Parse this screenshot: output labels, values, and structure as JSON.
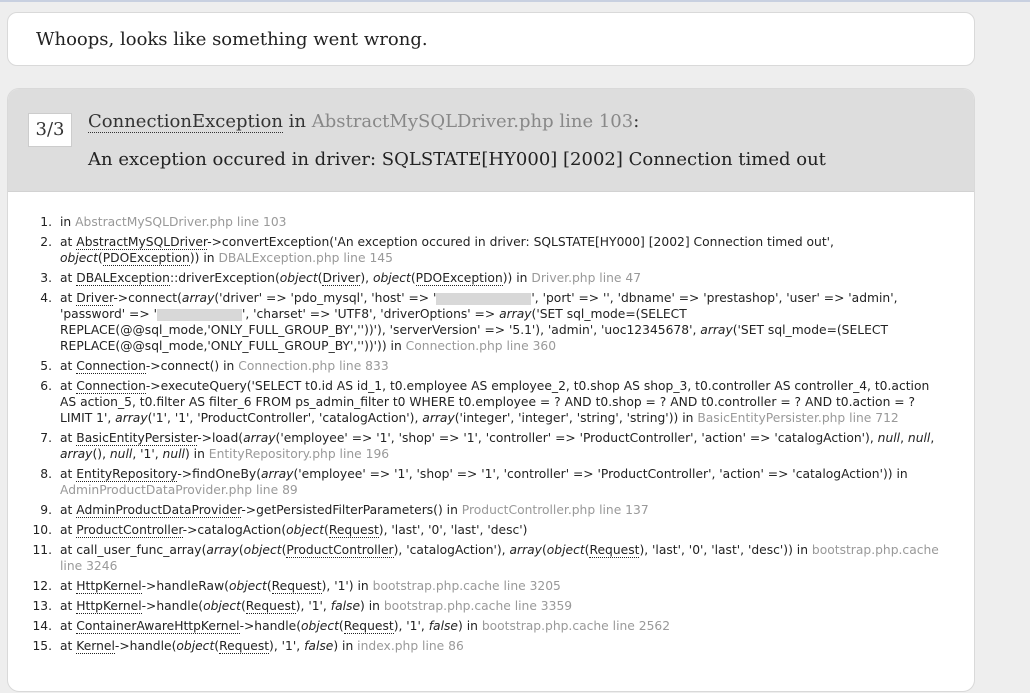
{
  "page": {
    "headline": "Whoops, looks like something went wrong."
  },
  "exception": {
    "counter": "3/3",
    "class_name": "ConnectionException",
    "in_text": "in",
    "location": "AbstractMySQLDriver.php line 103",
    "colon": ":",
    "message": "An exception occured in driver: SQLSTATE[HY000] [2002] Connection timed out"
  },
  "traces": [
    {
      "n": "1.",
      "parts": [
        [
          "t",
          "in "
        ],
        [
          "f",
          "AbstractMySQLDriver.php line 103"
        ]
      ]
    },
    {
      "n": "2.",
      "parts": [
        [
          "t",
          "at "
        ],
        [
          "c",
          "AbstractMySQLDriver"
        ],
        [
          "t",
          "->convertException('An exception occured in driver: SQLSTATE[HY000] [2002] Connection timed out', "
        ],
        [
          "i",
          "object"
        ],
        [
          "t",
          "("
        ],
        [
          "c",
          "PDOException"
        ],
        [
          "t",
          ")) in "
        ],
        [
          "f",
          "DBALException.php line 145"
        ]
      ]
    },
    {
      "n": "3.",
      "parts": [
        [
          "t",
          "at "
        ],
        [
          "c",
          "DBALException"
        ],
        [
          "t",
          "::driverException("
        ],
        [
          "i",
          "object"
        ],
        [
          "t",
          "("
        ],
        [
          "c",
          "Driver"
        ],
        [
          "t",
          "), "
        ],
        [
          "i",
          "object"
        ],
        [
          "t",
          "("
        ],
        [
          "c",
          "PDOException"
        ],
        [
          "t",
          ")) in "
        ],
        [
          "f",
          "Driver.php line 47"
        ]
      ]
    },
    {
      "n": "4.",
      "parts": [
        [
          "t",
          "at "
        ],
        [
          "c",
          "Driver"
        ],
        [
          "t",
          "->connect("
        ],
        [
          "i",
          "array"
        ],
        [
          "t",
          "('driver' => 'pdo_mysql', 'host' => '"
        ],
        [
          "r",
          "95"
        ],
        [
          "t",
          "', 'port' => '', 'dbname' => 'prestashop', 'user' => 'admin', 'password' => '"
        ],
        [
          "r",
          "85"
        ],
        [
          "t",
          "', 'charset' => 'UTF8', 'driverOptions' => "
        ],
        [
          "i",
          "array"
        ],
        [
          "t",
          "('SET sql_mode=(SELECT REPLACE(@@sql_mode,'ONLY_FULL_GROUP_BY',''))'), 'serverVersion' => '5.1'), 'admin', 'uoc12345678', "
        ],
        [
          "i",
          "array"
        ],
        [
          "t",
          "('SET sql_mode=(SELECT REPLACE(@@sql_mode,'ONLY_FULL_GROUP_BY',''))')) in "
        ],
        [
          "f",
          "Connection.php line 360"
        ]
      ]
    },
    {
      "n": "5.",
      "parts": [
        [
          "t",
          "at "
        ],
        [
          "c",
          "Connection"
        ],
        [
          "t",
          "->connect() in "
        ],
        [
          "f",
          "Connection.php line 833"
        ]
      ]
    },
    {
      "n": "6.",
      "parts": [
        [
          "t",
          "at "
        ],
        [
          "c",
          "Connection"
        ],
        [
          "t",
          "->executeQuery('SELECT t0.id AS id_1, t0.employee AS employee_2, t0.shop AS shop_3, t0.controller AS controller_4, t0.action AS action_5, t0.filter AS filter_6 FROM ps_admin_filter t0 WHERE t0.employee = ? AND t0.shop = ? AND t0.controller = ? AND t0.action = ? LIMIT 1', "
        ],
        [
          "i",
          "array"
        ],
        [
          "t",
          "('1', '1', 'ProductController', 'catalogAction'), "
        ],
        [
          "i",
          "array"
        ],
        [
          "t",
          "('integer', 'integer', 'string', 'string')) in "
        ],
        [
          "f",
          "BasicEntityPersister.php line 712"
        ]
      ]
    },
    {
      "n": "7.",
      "parts": [
        [
          "t",
          "at "
        ],
        [
          "c",
          "BasicEntityPersister"
        ],
        [
          "t",
          "->load("
        ],
        [
          "i",
          "array"
        ],
        [
          "t",
          "('employee' => '1', 'shop' => '1', 'controller' => 'ProductController', 'action' => 'catalogAction'), "
        ],
        [
          "i",
          "null"
        ],
        [
          "t",
          ", "
        ],
        [
          "i",
          "null"
        ],
        [
          "t",
          ", "
        ],
        [
          "i",
          "array"
        ],
        [
          "t",
          "(), "
        ],
        [
          "i",
          "null"
        ],
        [
          "t",
          ", '1', "
        ],
        [
          "i",
          "null"
        ],
        [
          "t",
          ") in "
        ],
        [
          "f",
          "EntityRepository.php line 196"
        ]
      ]
    },
    {
      "n": "8.",
      "parts": [
        [
          "t",
          "at "
        ],
        [
          "c",
          "EntityRepository"
        ],
        [
          "t",
          "->findOneBy("
        ],
        [
          "i",
          "array"
        ],
        [
          "t",
          "('employee' => '1', 'shop' => '1', 'controller' => 'ProductController', 'action' => 'catalogAction')) in "
        ],
        [
          "f",
          "AdminProductDataProvider.php line 89"
        ]
      ]
    },
    {
      "n": "9.",
      "parts": [
        [
          "t",
          "at "
        ],
        [
          "c",
          "AdminProductDataProvider"
        ],
        [
          "t",
          "->getPersistedFilterParameters() in "
        ],
        [
          "f",
          "ProductController.php line 137"
        ]
      ]
    },
    {
      "n": "10.",
      "parts": [
        [
          "t",
          "at "
        ],
        [
          "c",
          "ProductController"
        ],
        [
          "t",
          "->catalogAction("
        ],
        [
          "i",
          "object"
        ],
        [
          "t",
          "("
        ],
        [
          "c",
          "Request"
        ],
        [
          "t",
          "), 'last', '0', 'last', 'desc')"
        ]
      ]
    },
    {
      "n": "11.",
      "parts": [
        [
          "t",
          "at call_user_func_array("
        ],
        [
          "i",
          "array"
        ],
        [
          "t",
          "("
        ],
        [
          "i",
          "object"
        ],
        [
          "t",
          "("
        ],
        [
          "c",
          "ProductController"
        ],
        [
          "t",
          "), 'catalogAction'), "
        ],
        [
          "i",
          "array"
        ],
        [
          "t",
          "("
        ],
        [
          "i",
          "object"
        ],
        [
          "t",
          "("
        ],
        [
          "c",
          "Request"
        ],
        [
          "t",
          "), 'last', '0', 'last', 'desc')) in "
        ],
        [
          "f",
          "bootstrap.php.cache line 3246"
        ]
      ]
    },
    {
      "n": "12.",
      "parts": [
        [
          "t",
          "at "
        ],
        [
          "c",
          "HttpKernel"
        ],
        [
          "t",
          "->handleRaw("
        ],
        [
          "i",
          "object"
        ],
        [
          "t",
          "("
        ],
        [
          "c",
          "Request"
        ],
        [
          "t",
          "), '1') in "
        ],
        [
          "f",
          "bootstrap.php.cache line 3205"
        ]
      ]
    },
    {
      "n": "13.",
      "parts": [
        [
          "t",
          "at "
        ],
        [
          "c",
          "HttpKernel"
        ],
        [
          "t",
          "->handle("
        ],
        [
          "i",
          "object"
        ],
        [
          "t",
          "("
        ],
        [
          "c",
          "Request"
        ],
        [
          "t",
          "), '1', "
        ],
        [
          "i",
          "false"
        ],
        [
          "t",
          ") in "
        ],
        [
          "f",
          "bootstrap.php.cache line 3359"
        ]
      ]
    },
    {
      "n": "14.",
      "parts": [
        [
          "t",
          "at "
        ],
        [
          "c",
          "ContainerAwareHttpKernel"
        ],
        [
          "t",
          "->handle("
        ],
        [
          "i",
          "object"
        ],
        [
          "t",
          "("
        ],
        [
          "c",
          "Request"
        ],
        [
          "t",
          "), '1', "
        ],
        [
          "i",
          "false"
        ],
        [
          "t",
          ") in "
        ],
        [
          "f",
          "bootstrap.php.cache line 2562"
        ]
      ]
    },
    {
      "n": "15.",
      "parts": [
        [
          "t",
          "at "
        ],
        [
          "c",
          "Kernel"
        ],
        [
          "t",
          "->handle("
        ],
        [
          "i",
          "object"
        ],
        [
          "t",
          "("
        ],
        [
          "c",
          "Request"
        ],
        [
          "t",
          "), '1', "
        ],
        [
          "i",
          "false"
        ],
        [
          "t",
          ") in "
        ],
        [
          "f",
          "index.php line 86"
        ]
      ]
    }
  ]
}
